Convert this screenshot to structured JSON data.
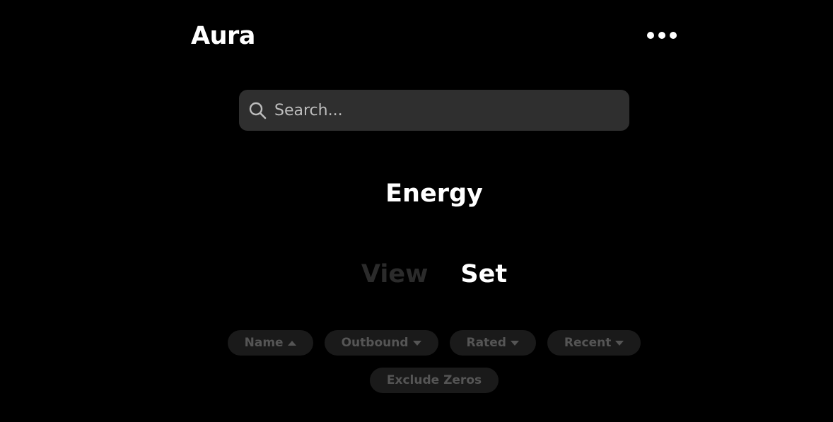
{
  "header": {
    "logo": "Aura",
    "more_icon": "more-horizontal-icon"
  },
  "search": {
    "placeholder": "Search...",
    "value": "",
    "icon": "search-icon"
  },
  "title": "Energy",
  "mode_toggle": {
    "options": [
      "View",
      "Set"
    ],
    "selected": "Set"
  },
  "sort_buttons": [
    {
      "label": "Name",
      "direction": "up"
    },
    {
      "label": "Outbound",
      "direction": "down"
    },
    {
      "label": "Rated",
      "direction": "down"
    },
    {
      "label": "Recent",
      "direction": "down"
    }
  ],
  "filter": {
    "exclude_zeros_label": "Exclude Zeros"
  },
  "colors": {
    "background": "#000000",
    "search_bg": "#2f2f2f",
    "pill_bg": "#1a1a1a",
    "pill_text": "#555555",
    "inactive_toggle": "#2b2b2b",
    "active_text": "#ffffff"
  }
}
